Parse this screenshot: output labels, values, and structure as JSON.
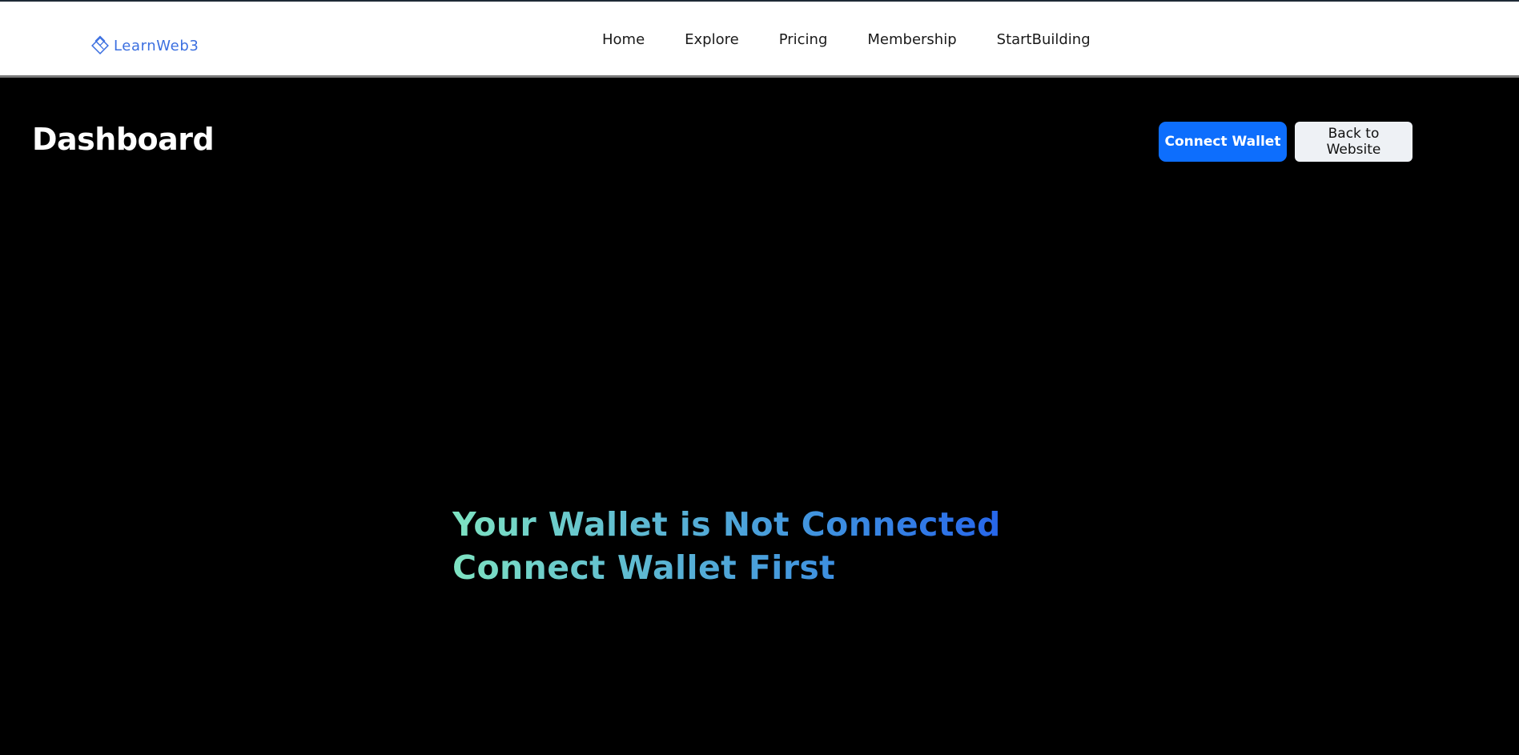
{
  "navbar": {
    "logo": {
      "text": "LearnWeb3",
      "icon": "learnweb3-diamond-icon",
      "color": "#3b6fe0"
    },
    "links": [
      {
        "label": "Home"
      },
      {
        "label": "Explore"
      },
      {
        "label": "Pricing"
      },
      {
        "label": "Membership"
      },
      {
        "label": "StartBuilding"
      }
    ]
  },
  "dashboard": {
    "title": "Dashboard",
    "connect_wallet_label": "Connect Wallet",
    "back_to_website_label": "Back to Website"
  },
  "message": {
    "line1": "Your Wallet is Not Connected !",
    "line2": "Connect Wallet First"
  },
  "colors": {
    "background": "#000000",
    "primary_button": "#0d6efd",
    "secondary_button": "#eef1f5",
    "gradient_start": "#7ee3c2",
    "gradient_end": "#2563eb"
  }
}
